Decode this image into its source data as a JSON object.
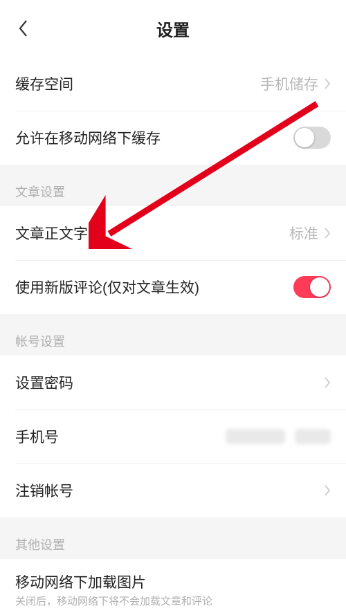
{
  "header": {
    "title": "设置"
  },
  "group_storage": {
    "cache_label": "缓存空间",
    "cache_value": "手机储存",
    "mobile_cache_label": "允许在移动网络下缓存"
  },
  "section_article": {
    "header": "文章设置",
    "font_label": "文章正文字号",
    "font_value": "标准",
    "new_comment_label": "使用新版评论(仅对文章生效)"
  },
  "section_account": {
    "header": "帐号设置",
    "password_label": "设置密码",
    "phone_label": "手机号",
    "logout_label": "注销帐号"
  },
  "section_other": {
    "header": "其他设置",
    "load_img_label": "移动网络下加载图片",
    "load_img_desc": "关闭后，移动网络下将不会加载文章和评论"
  }
}
